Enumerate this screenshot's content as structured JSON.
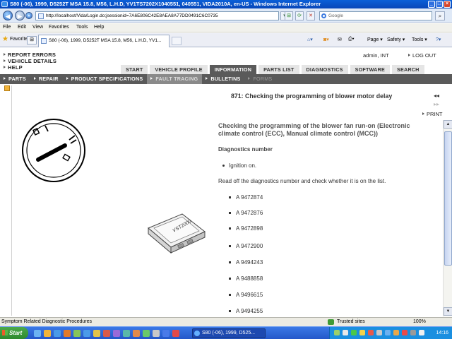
{
  "window": {
    "title": "S80 (-06), 1999, D5252T MSA 15.8, M56, L.H.D, YV1TS7202X1040551, 040551, VIDA2010A, en-US - Windows Internet Explorer"
  },
  "address": {
    "url": "http://localhost/Vida/Login.do;jsessionid=7A6E806C42E8AEA8A77DD0491C6C0735"
  },
  "search": {
    "placeholder": "Google"
  },
  "menu": {
    "items": [
      "File",
      "Edit",
      "View",
      "Favorites",
      "Tools",
      "Help"
    ]
  },
  "favorites": {
    "label": "Favorites",
    "tab_title": "S80 (-06), 1999, D5252T MSA 15.8, M56, L.H.D, YV1..."
  },
  "commands": {
    "page": "Page ▾",
    "safety": "Safety ▾",
    "tools": "Tools ▾",
    "help": "?▾"
  },
  "vida": {
    "left_links": [
      "REPORT ERRORS",
      "VEHICLE DETAILS",
      "HELP"
    ],
    "user": "admin, INT",
    "logout": "LOG OUT",
    "tabs": [
      "START",
      "VEHICLE PROFILE",
      "INFORMATION",
      "PARTS LIST",
      "DIAGNOSTICS",
      "SOFTWARE",
      "SEARCH"
    ],
    "active_tab": "INFORMATION",
    "subnav": [
      "PARTS",
      "REPAIR",
      "PRODUCT SPECIFICATIONS",
      "FAULT TRACING",
      "BULLETINS",
      "FORMS"
    ],
    "active_subnav": "FAULT TRACING",
    "print": "PRINT"
  },
  "document": {
    "title": "871: Checking the programming of blower motor delay",
    "heading": "Checking the programming of the blower fan run-on (Electronic climate control (ECC), Manual climate control (MCC))",
    "subheading": "Diagnostics number",
    "bullet": "Ignition on.",
    "paragraph": "Read off the diagnostics number and check whether it is on the list.",
    "codes": [
      "A 9472874",
      "A 9472876",
      "A 9472898",
      "A 9472900",
      "A 9494243",
      "A 9488858",
      "A 9496615",
      "A 9494255"
    ],
    "device_label": "VST2000"
  },
  "status": {
    "text": "Symptom Related Diagnostic Procedures",
    "zone": "Trusted sites",
    "zoom": "100%"
  },
  "taskbar": {
    "start": "Start",
    "window": "S80 (-06), 1999, D525...",
    "clock": "14:16"
  }
}
